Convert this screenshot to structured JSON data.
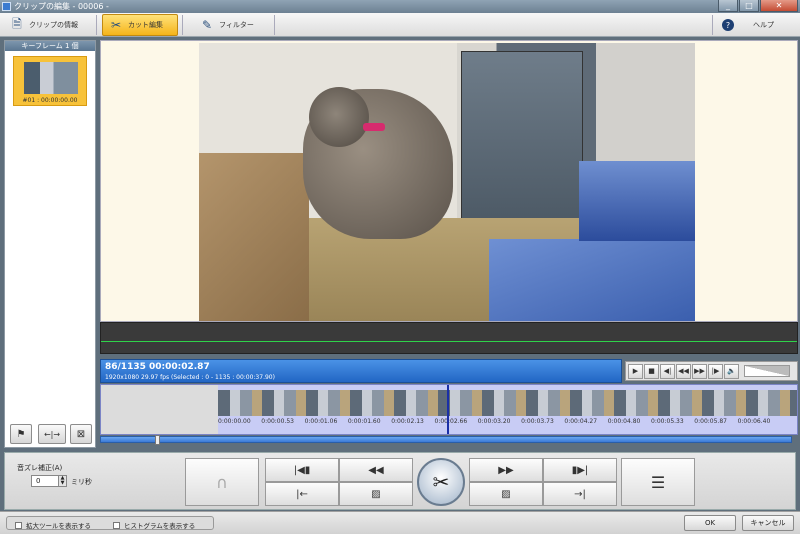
{
  "window": {
    "title": "クリップの編集 - 00006 -",
    "min": "_",
    "max": "□",
    "close": "✕"
  },
  "toolbar": {
    "clip_info": "クリップの情報",
    "cut_edit": "カット編集",
    "filter": "フィルター",
    "help": "ヘルプ"
  },
  "keyframes": {
    "header": "キーフレーム 1 個",
    "items": [
      {
        "label": "#01 : 00:00:00.00"
      }
    ]
  },
  "left_buttons": {
    "flag": "⚑",
    "fit": "←|→",
    "delete": "⊠"
  },
  "playback": {
    "frame_time": "86/1135  00:00:02.87",
    "detail": "1920x1080 29.97 fps  (Selected : 0 - 1135 : 00:00:37.90)"
  },
  "transport": {
    "play": "▶",
    "stop": "■",
    "prev_frame": "◀|",
    "rewind": "◀◀",
    "forward": "▶▶",
    "next_frame": "|▶",
    "volume_icon": "🔈"
  },
  "timeline": {
    "timecodes": [
      "0:00:00.00",
      "0:00:00.53",
      "0:00:01.06",
      "0:00:01.60",
      "0:00:02.13",
      "0:00:02.66",
      "0:00:03.20",
      "0:00:03.73",
      "0:00:04.27",
      "0:00:04.80",
      "0:00:05.33",
      "0:00:05.87",
      "0:00:06.40"
    ],
    "scroll_position": 0.08
  },
  "audio_offset": {
    "label": "音ズレ補正(A)",
    "value": "0",
    "unit": "ミリ秒"
  },
  "edit_buttons": {
    "undo": "∩",
    "cut": "✂",
    "menu": "☰"
  },
  "footer": {
    "show_zoom_tool": "拡大ツールを表示する",
    "show_histogram": "ヒストグラムを表示する",
    "ok": "OK",
    "cancel": "キャンセル"
  },
  "colors": {
    "accent": "#f5b41a",
    "info_bar": "#2266c4",
    "timeline": "#c8ccf5",
    "waveform": "#2fd34a"
  }
}
